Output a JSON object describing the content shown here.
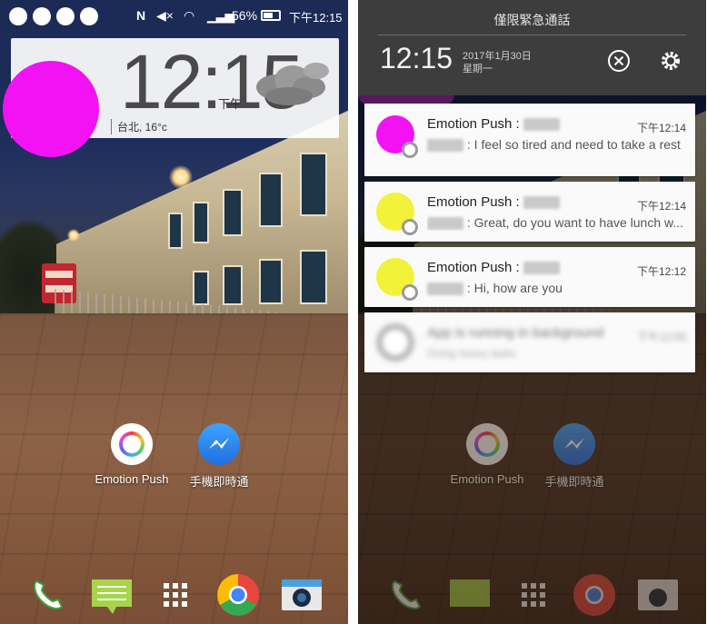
{
  "colors": {
    "magenta": "#f212f4",
    "yellow": "#f2f23a",
    "notif_bg": "#fafafa",
    "shade_bg": "#3d3d3d"
  },
  "status_bar": {
    "battery": "56%",
    "clock": "下午12:15",
    "icons": [
      "nfc-icon",
      "mute-icon",
      "wifi-icon",
      "signal-icon",
      "battery-icon"
    ]
  },
  "clock_widget": {
    "time": "12:15",
    "ampm": "下午",
    "location": "台北, 16°c"
  },
  "home": {
    "apps": [
      {
        "label": "Emotion Push",
        "icon": "emotion-push-icon"
      },
      {
        "label": "手機即時通",
        "icon": "messenger-icon"
      }
    ],
    "dock": [
      "phone-icon",
      "messages-icon",
      "app-drawer-icon",
      "chrome-icon",
      "camera-icon"
    ]
  },
  "notification_shade": {
    "emergency": "僅限緊急通話",
    "time": "12:15",
    "date": "2017年1月30日",
    "weekday": "星期一"
  },
  "notifications": [
    {
      "title": "Emotion Push :",
      "time": "下午12:14",
      "body": ": I feel so tired and need to take a rest",
      "avatar_color": "magenta"
    },
    {
      "title": "Emotion Push :",
      "time": "下午12:14",
      "body": ": Great, do you want to have lunch w...",
      "avatar_color": "yellow"
    },
    {
      "title": "Emotion Push :",
      "time": "下午12:12",
      "body": ": Hi, how are you",
      "avatar_color": "yellow"
    },
    {
      "title": "App is running in background",
      "time": "下午12:00",
      "body": "Doing heavy tasks"
    }
  ]
}
